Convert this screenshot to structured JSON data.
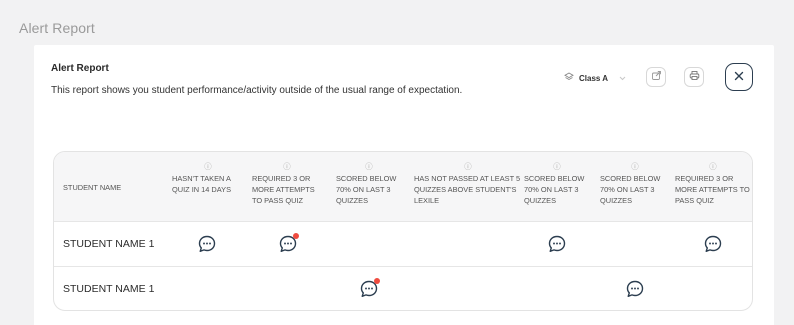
{
  "page": {
    "title": "Alert Report"
  },
  "card": {
    "title": "Alert Report",
    "description": "This report shows you student performance/activity outside of the usual range of expectation."
  },
  "class_selector": {
    "value": "Class A",
    "icon": "layers-icon"
  },
  "toolbar": {
    "share_icon": "share-icon",
    "print_icon": "print-icon",
    "close_icon": "close-icon"
  },
  "table": {
    "name_header": "STUDENT NAME",
    "columns": [
      {
        "label": "HASN'T TAKEN A QUIZ IN 14 DAYS"
      },
      {
        "label": "REQUIRED 3 OR MORE ATTEMPTS TO PASS QUIZ"
      },
      {
        "label": "SCORED BELOW 70% ON LAST 3 QUIZZES"
      },
      {
        "label": "HAS NOT PASSED AT LEAST 5 QUIZZES ABOVE STUDENT'S LEXILE"
      },
      {
        "label": "SCORED BELOW 70% ON LAST 3 QUIZZES"
      },
      {
        "label": "SCORED BELOW 70% ON LAST 3 QUIZZES"
      },
      {
        "label": "REQUIRED 3 OR MORE ATTEMPTS TO PASS QUIZ"
      }
    ],
    "rows": [
      {
        "name": "STUDENT NAME 1",
        "alerts": [
          "plain",
          "new",
          null,
          null,
          "plain",
          null,
          "plain"
        ]
      },
      {
        "name": "STUDENT NAME 1",
        "alerts": [
          null,
          null,
          "new",
          null,
          null,
          "plain",
          null
        ]
      }
    ]
  },
  "colors": {
    "accent_dot": "#ef4b3f",
    "close_border": "#2c3e50"
  }
}
